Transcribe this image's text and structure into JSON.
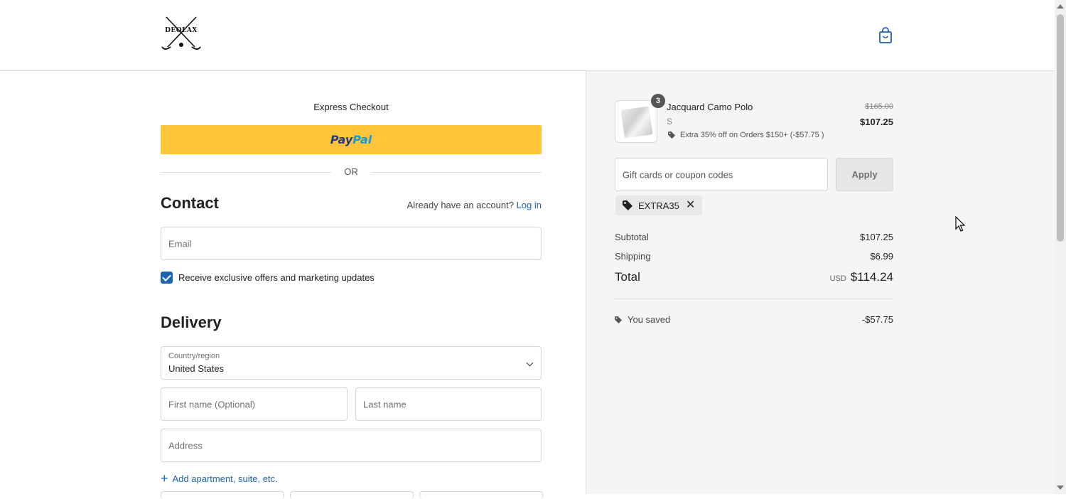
{
  "header": {
    "logo_text": "DEOLAX",
    "cart_icon": "shopping-bag-icon"
  },
  "express": {
    "title": "Express Checkout",
    "paypal_part1": "Pay",
    "paypal_part2": "Pal",
    "or": "OR"
  },
  "contact": {
    "heading": "Contact",
    "account_prompt": "Already have an account?",
    "login_label": "Log in",
    "email_placeholder": "Email",
    "marketing_label": "Receive exclusive offers and marketing updates",
    "marketing_checked": true
  },
  "delivery": {
    "heading": "Delivery",
    "country_label": "Country/region",
    "country_value": "United States",
    "first_name_placeholder": "First name (Optional)",
    "last_name_placeholder": "Last name",
    "address_placeholder": "Address",
    "add_apartment_label": "Add apartment, suite, etc."
  },
  "summary": {
    "item": {
      "name": "Jacquard Camo Polo",
      "variant": "S",
      "quantity": "3",
      "discount_text": "Extra 35% off on Orders $150+ (-$57.75 )",
      "original_price": "$165.00",
      "price": "$107.25"
    },
    "coupon_placeholder": "Gift cards or coupon codes",
    "apply_label": "Apply",
    "applied_code": "EXTRA35",
    "subtotal_label": "Subtotal",
    "subtotal_value": "$107.25",
    "shipping_label": "Shipping",
    "shipping_value": "$6.99",
    "total_label": "Total",
    "currency": "USD",
    "total_value": "$114.24",
    "saved_label": "You saved",
    "saved_value": "-$57.75"
  },
  "colors": {
    "accent": "#1b63b3",
    "paypal_yellow": "#ffc439",
    "summary_bg": "#f5f5f6"
  }
}
